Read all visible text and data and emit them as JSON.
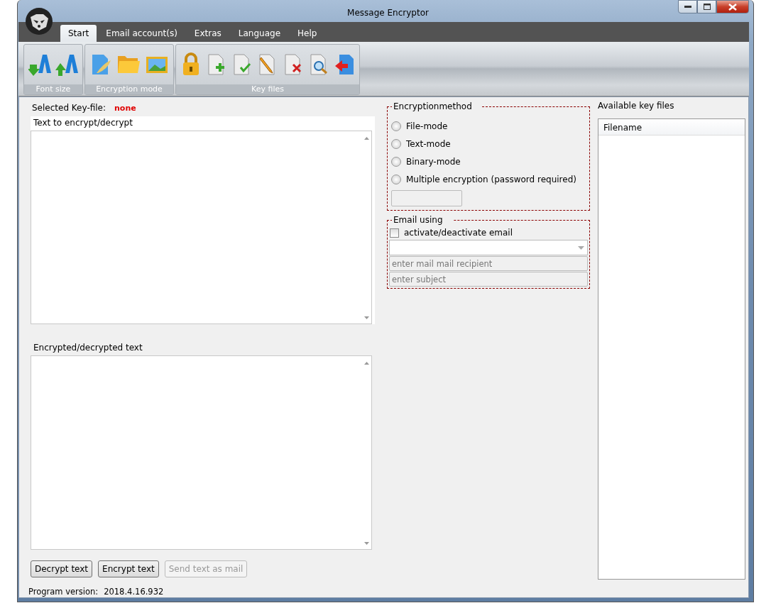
{
  "window": {
    "title": "Message Encryptor"
  },
  "tabs": [
    {
      "label": "Start",
      "selected": true
    },
    {
      "label": "Email account(s)",
      "selected": false
    },
    {
      "label": "Extras",
      "selected": false
    },
    {
      "label": "Language",
      "selected": false
    },
    {
      "label": "Help",
      "selected": false
    }
  ],
  "ribbon_groups": [
    {
      "kind": "font",
      "label": "Font size"
    },
    {
      "kind": "mode",
      "label": "Encryption mode"
    },
    {
      "kind": "keys",
      "label": "Key files"
    }
  ],
  "selected_key_file": {
    "label": "Selected Key-file:",
    "value": "none"
  },
  "input_text": {
    "label": "Text to encrypt/decrypt"
  },
  "output_text": {
    "label": "Encrypted/decrypted text"
  },
  "encryption_method": {
    "legend": "Encryptionmethod",
    "options": [
      {
        "label": "File-mode",
        "selected": false
      },
      {
        "label": "Text-mode",
        "selected": false
      },
      {
        "label": "Binary-mode",
        "selected": false
      },
      {
        "label": "Multiple encryption (password required)",
        "selected": false
      }
    ]
  },
  "email": {
    "legend": "Email using",
    "checkbox": {
      "label": "activate/deactivate email",
      "checked": false
    },
    "recipient": {
      "placeholder": "enter mail mail recipient"
    },
    "subject": {
      "placeholder": "enter subject"
    }
  },
  "key_files": {
    "title": "Available key files",
    "columns": [
      "Filename"
    ]
  },
  "buttons": [
    {
      "label": "Decrypt text",
      "disabled": false
    },
    {
      "label": "Encrypt text",
      "disabled": false
    },
    {
      "label": "Send text as mail",
      "disabled": true
    }
  ],
  "status": {
    "label": "Program version:",
    "value": "2018.4.16.932"
  }
}
